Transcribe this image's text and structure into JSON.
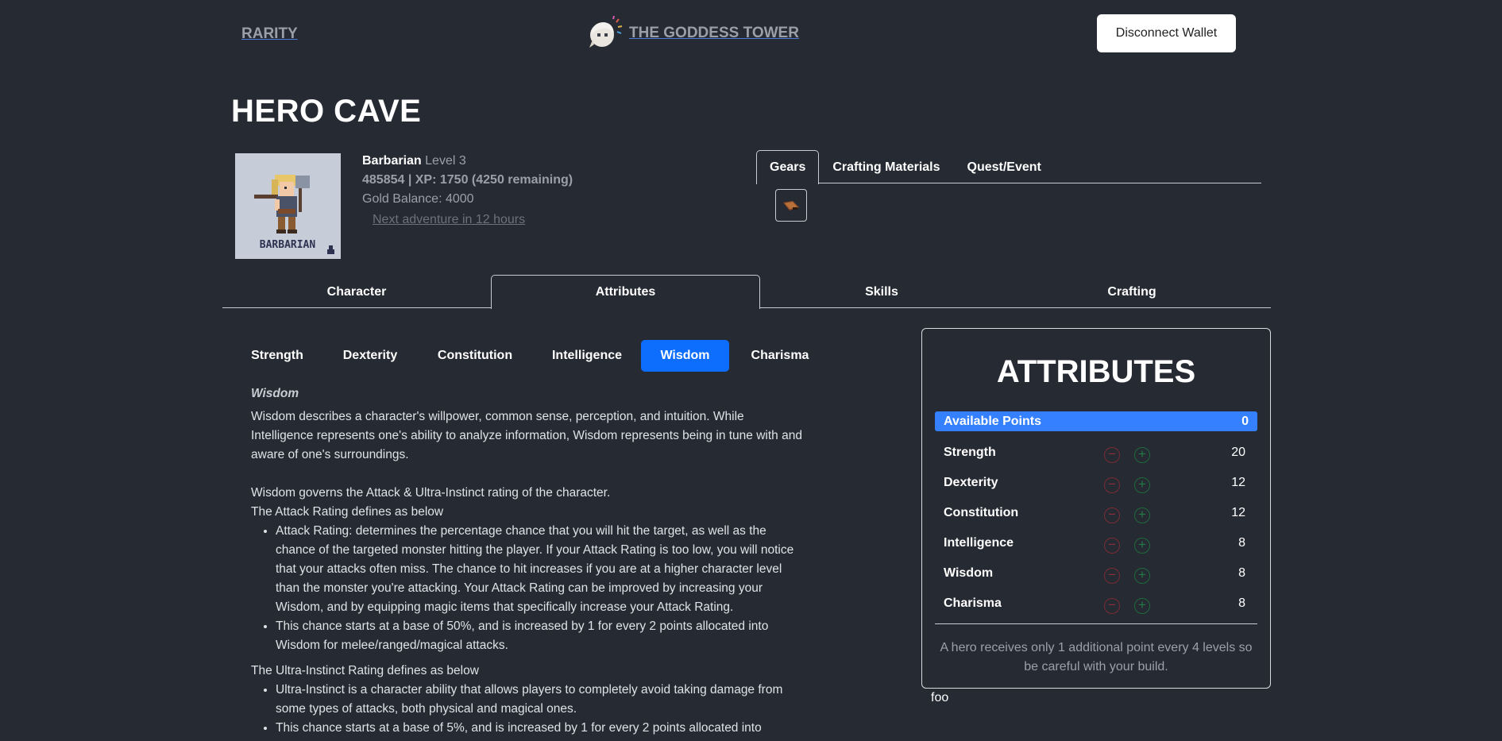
{
  "nav": {
    "brand": "RARITY",
    "center_title": "THE GODDESS TOWER",
    "wallet_button": "Disconnect Wallet"
  },
  "page_title": "HERO CAVE",
  "hero": {
    "class": "Barbarian",
    "level": "Level 3",
    "xp_line": "485854 | XP: 1750 (4250 remaining)",
    "gold": "Gold Balance: 4000",
    "next_adventure": "Next adventure in 12 hours",
    "portrait_label": "BARBARIAN"
  },
  "inventory_tabs": [
    "Gears",
    "Crafting Materials",
    "Quest/Event"
  ],
  "main_tabs": [
    "Character",
    "Attributes",
    "Skills",
    "Crafting"
  ],
  "attribute_pills": [
    "Strength",
    "Dexterity",
    "Constitution",
    "Intelligence",
    "Wisdom",
    "Charisma"
  ],
  "description": {
    "heading": "Wisdom",
    "intro": "Wisdom describes a character's willpower, common sense, perception, and intuition. While Intelligence represents one's ability to analyze information, Wisdom represents being in tune with and aware of one's surroundings.",
    "governs": "Wisdom governs the Attack & Ultra-Instinct rating of the character.",
    "attack_heading": "The Attack Rating defines as below",
    "attack_points": [
      "Attack Rating: determines the percentage chance that you will hit the target, as well as the chance of the targeted monster hitting the player. If your Attack Rating is too low, you will notice that your attacks often miss. The chance to hit increases if you are at a higher character level than the monster you're attacking. Your Attack Rating can be improved by increasing your Wisdom, and by equipping magic items that specifically increase your Attack Rating.",
      "This chance starts at a base of 50%, and is increased by 1 for every 2 points allocated into Wisdom for melee/ranged/magical attacks."
    ],
    "ultra_heading": "The Ultra-Instinct Rating defines as below",
    "ultra_points": [
      "Ultra-Instinct is a character ability that allows players to completely avoid taking damage from some types of attacks, both physical and magical ones.",
      "This chance starts at a base of 5%, and is increased by 1 for every 2 points allocated into"
    ]
  },
  "panel": {
    "title": "ATTRIBUTES",
    "available_label": "Available Points",
    "available_value": "0",
    "attributes": [
      {
        "name": "Strength",
        "value": "20"
      },
      {
        "name": "Dexterity",
        "value": "12"
      },
      {
        "name": "Constitution",
        "value": "12"
      },
      {
        "name": "Intelligence",
        "value": "8"
      },
      {
        "name": "Wisdom",
        "value": "8"
      },
      {
        "name": "Charisma",
        "value": "8"
      }
    ],
    "minus_symbol": "−",
    "plus_symbol": "+",
    "note": "A hero receives only 1 additional point every 4 levels so be careful with your build."
  },
  "footer_text": "foo",
  "colors": {
    "background": "#262a33",
    "accent": "#0d6efd",
    "available_bar": "#3580ff"
  }
}
